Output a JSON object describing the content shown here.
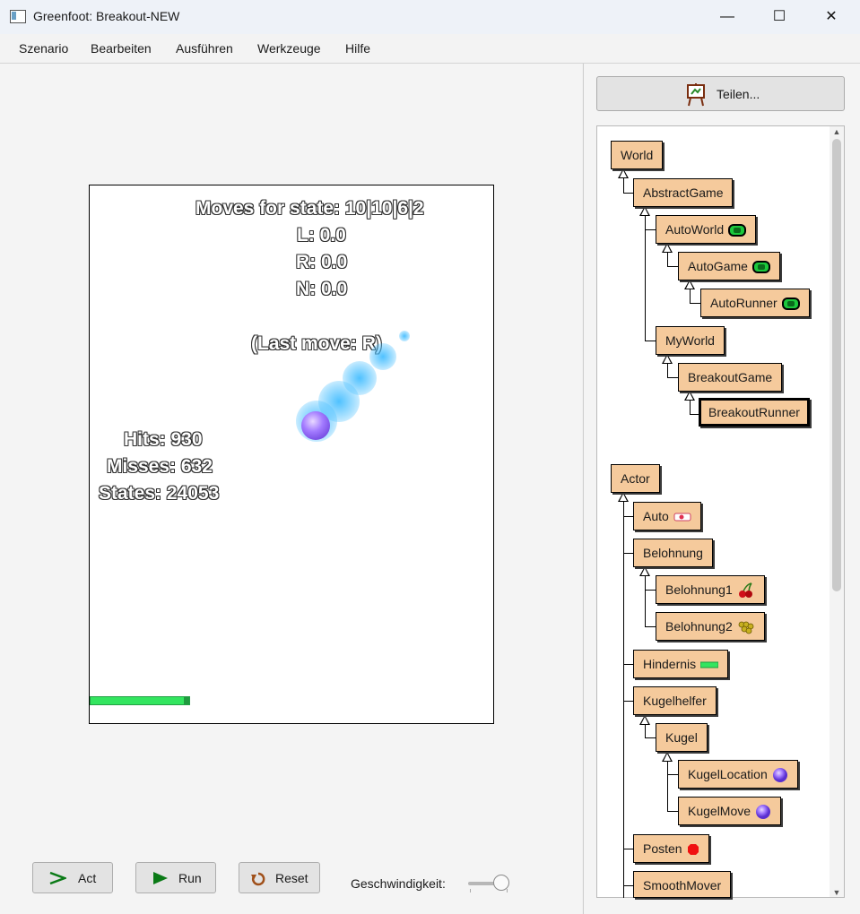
{
  "window": {
    "title": "Greenfoot: Breakout-NEW",
    "min": "—",
    "max": "☐",
    "close": "✕"
  },
  "menu": [
    "Szenario",
    "Bearbeiten",
    "Ausführen",
    "Werkzeuge",
    "Hilfe"
  ],
  "world": {
    "moves": "Moves for state: 10|10|6|2",
    "l": "L: 0.0",
    "r": "R: 0.0",
    "n": "N: 0.0",
    "last_move": "(Last move: R)",
    "hits": "Hits: 930",
    "misses": "Misses: 632",
    "states": "States: 24053"
  },
  "controls": {
    "act": "Act",
    "run": "Run",
    "reset": "Reset",
    "speed_label": "Geschwindigkeit:",
    "speed_value": 0.85
  },
  "share": {
    "label": "Teilen..."
  },
  "world_classes": [
    "World",
    "AbstractGame",
    "AutoWorld",
    "AutoGame",
    "AutoRunner",
    "MyWorld",
    "BreakoutGame",
    "BreakoutRunner"
  ],
  "actor_classes": [
    "Actor",
    "Auto",
    "Belohnung",
    "Belohnung1",
    "Belohnung2",
    "Hindernis",
    "Kugelhelfer",
    "Kugel",
    "KugelLocation",
    "KugelMove",
    "Posten",
    "SmoothMover"
  ],
  "colors": {
    "class_box": "#f5ca9c",
    "paddle": "#33e55f",
    "ball": "#a37bff",
    "trail": "#46beff"
  }
}
